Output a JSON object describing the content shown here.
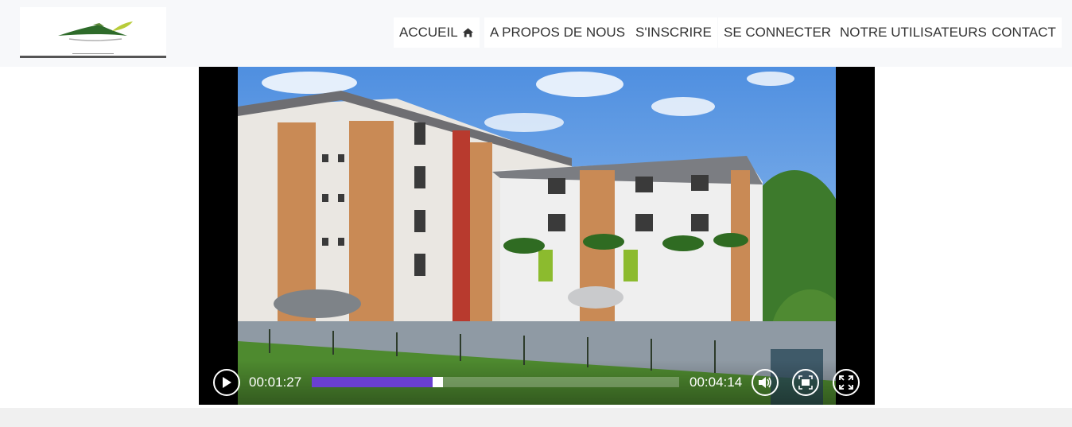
{
  "header": {
    "logo_alt": "logo",
    "nav": [
      {
        "label": "ACCUEIL",
        "icon": "home-icon"
      },
      {
        "label": "A PROPOS DE NOUS"
      },
      {
        "label": "S'INSCRIRE"
      },
      {
        "label": "SE CONNECTER"
      },
      {
        "label": "NOTRE UTILISATEURS"
      },
      {
        "label": "CONTACT"
      }
    ]
  },
  "video": {
    "current_time": "00:01:27",
    "duration": "00:04:14",
    "progress_fraction": 0.343,
    "progress_color": "#6a3fd0",
    "controls": {
      "play_icon": "play-icon",
      "volume_icon": "volume-icon",
      "fit_icon": "fit-screen-icon",
      "fullscreen_icon": "fullscreen-icon"
    }
  }
}
